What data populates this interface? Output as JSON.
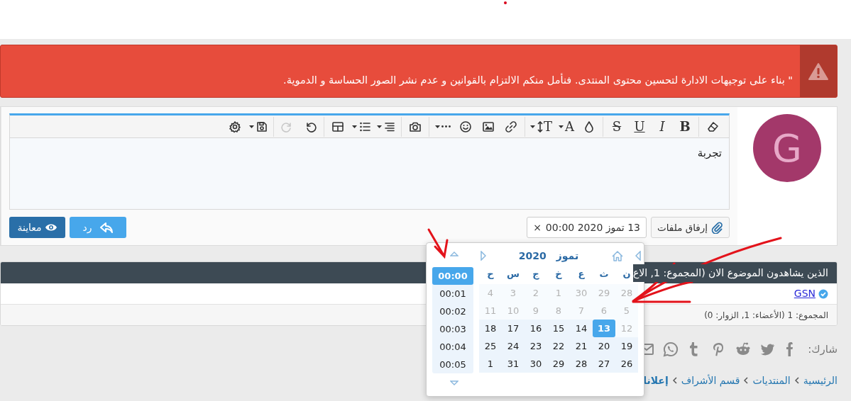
{
  "alert": {
    "text": "\" بناء على توجيهات الادارة لتحسين محتوى المنتدى. فنأمل منكم الالتزام بالقوانين و عدم نشر الصور الحساسة و الدموية."
  },
  "avatar": {
    "letter": "G"
  },
  "editor": {
    "toolbar": [
      [
        {
          "kind": "eraser",
          "disabled": false
        }
      ],
      [
        {
          "kind": "bold",
          "label": "B",
          "disabled": false
        },
        {
          "kind": "italic",
          "label": "I",
          "disabled": false
        },
        {
          "kind": "underline",
          "label": "U",
          "disabled": false
        },
        {
          "kind": "strike",
          "label": "S",
          "disabled": false
        }
      ],
      [
        {
          "kind": "drop",
          "disabled": false
        },
        {
          "kind": "fontcolor",
          "label": "A",
          "disabled": false
        },
        {
          "kind": "fontsize",
          "label": "T",
          "disabled": false
        }
      ],
      [
        {
          "kind": "link",
          "disabled": false
        },
        {
          "kind": "image",
          "disabled": false
        },
        {
          "kind": "smile",
          "disabled": false
        },
        {
          "kind": "more",
          "disabled": false
        }
      ],
      [
        {
          "kind": "camera",
          "disabled": false
        }
      ],
      [
        {
          "kind": "align",
          "disabled": false
        },
        {
          "kind": "list",
          "disabled": false
        },
        {
          "kind": "table",
          "disabled": false
        }
      ],
      [
        {
          "kind": "undo",
          "disabled": false
        },
        {
          "kind": "redo",
          "disabled": true
        }
      ],
      [
        {
          "kind": "save",
          "disabled": false
        },
        {
          "kind": "gear",
          "disabled": false
        }
      ]
    ],
    "content": "تجربة"
  },
  "attach_button": "إرفاق ملفات",
  "date_tag": {
    "text": "13 تموز 2020 00:00",
    "remove": "×"
  },
  "reply_button": "رد",
  "preview_button": "معاينة",
  "datepicker": {
    "month": "تموز",
    "year": "2020",
    "weekdays": [
      "ن",
      "ث",
      "ع",
      "خ",
      "ج",
      "س",
      "ح"
    ],
    "weeks": [
      [
        {
          "day": "28",
          "muted": true,
          "selected": false
        },
        {
          "day": "29",
          "muted": true,
          "selected": false
        },
        {
          "day": "30",
          "muted": true,
          "selected": false
        },
        {
          "day": "1",
          "muted": true,
          "selected": false
        },
        {
          "day": "2",
          "muted": true,
          "selected": false
        },
        {
          "day": "3",
          "muted": true,
          "selected": false
        },
        {
          "day": "4",
          "muted": true,
          "selected": false
        }
      ],
      [
        {
          "day": "5",
          "muted": true,
          "selected": false
        },
        {
          "day": "6",
          "muted": true,
          "selected": false
        },
        {
          "day": "7",
          "muted": true,
          "selected": false
        },
        {
          "day": "8",
          "muted": true,
          "selected": false
        },
        {
          "day": "9",
          "muted": true,
          "selected": false
        },
        {
          "day": "10",
          "muted": true,
          "selected": false
        },
        {
          "day": "11",
          "muted": true,
          "selected": false
        }
      ],
      [
        {
          "day": "12",
          "muted": true,
          "selected": false
        },
        {
          "day": "13",
          "muted": false,
          "selected": true
        },
        {
          "day": "14",
          "muted": false,
          "selected": false
        },
        {
          "day": "15",
          "muted": false,
          "selected": false
        },
        {
          "day": "16",
          "muted": false,
          "selected": false
        },
        {
          "day": "17",
          "muted": false,
          "selected": false
        },
        {
          "day": "18",
          "muted": false,
          "selected": false
        }
      ],
      [
        {
          "day": "19",
          "muted": false,
          "selected": false
        },
        {
          "day": "20",
          "muted": false,
          "selected": false
        },
        {
          "day": "21",
          "muted": false,
          "selected": false
        },
        {
          "day": "22",
          "muted": false,
          "selected": false
        },
        {
          "day": "23",
          "muted": false,
          "selected": false
        },
        {
          "day": "24",
          "muted": false,
          "selected": false
        },
        {
          "day": "25",
          "muted": false,
          "selected": false
        }
      ],
      [
        {
          "day": "26",
          "muted": false,
          "selected": false
        },
        {
          "day": "27",
          "muted": false,
          "selected": false
        },
        {
          "day": "28",
          "muted": false,
          "selected": false
        },
        {
          "day": "29",
          "muted": false,
          "selected": false
        },
        {
          "day": "30",
          "muted": false,
          "selected": false
        },
        {
          "day": "31",
          "muted": false,
          "selected": false
        },
        {
          "day": "1",
          "muted": false,
          "selected": false
        }
      ]
    ],
    "times": [
      {
        "text": "00:00",
        "selected": true
      },
      {
        "text": "00:01",
        "selected": false
      },
      {
        "text": "00:02",
        "selected": false
      },
      {
        "text": "00:03",
        "selected": false
      },
      {
        "text": "00:04",
        "selected": false
      },
      {
        "text": "00:05",
        "selected": false
      }
    ]
  },
  "viewers": {
    "title": "الذين يشاهدون الموضوع الان (المجموع: 1, الاع",
    "members": [
      {
        "name": "GSN",
        "verified": true
      }
    ],
    "total": "المجموع: 1 (الأعضاء: 1, الزوار: 0)"
  },
  "share": {
    "label": "شارك:"
  },
  "breadcrumbs": [
    {
      "text": "الرئيسية",
      "current": false
    },
    {
      "text": "المنتديات",
      "current": false
    },
    {
      "text": "قسم الأشراف",
      "current": false
    },
    {
      "text": "إعلانا",
      "current": true
    }
  ]
}
